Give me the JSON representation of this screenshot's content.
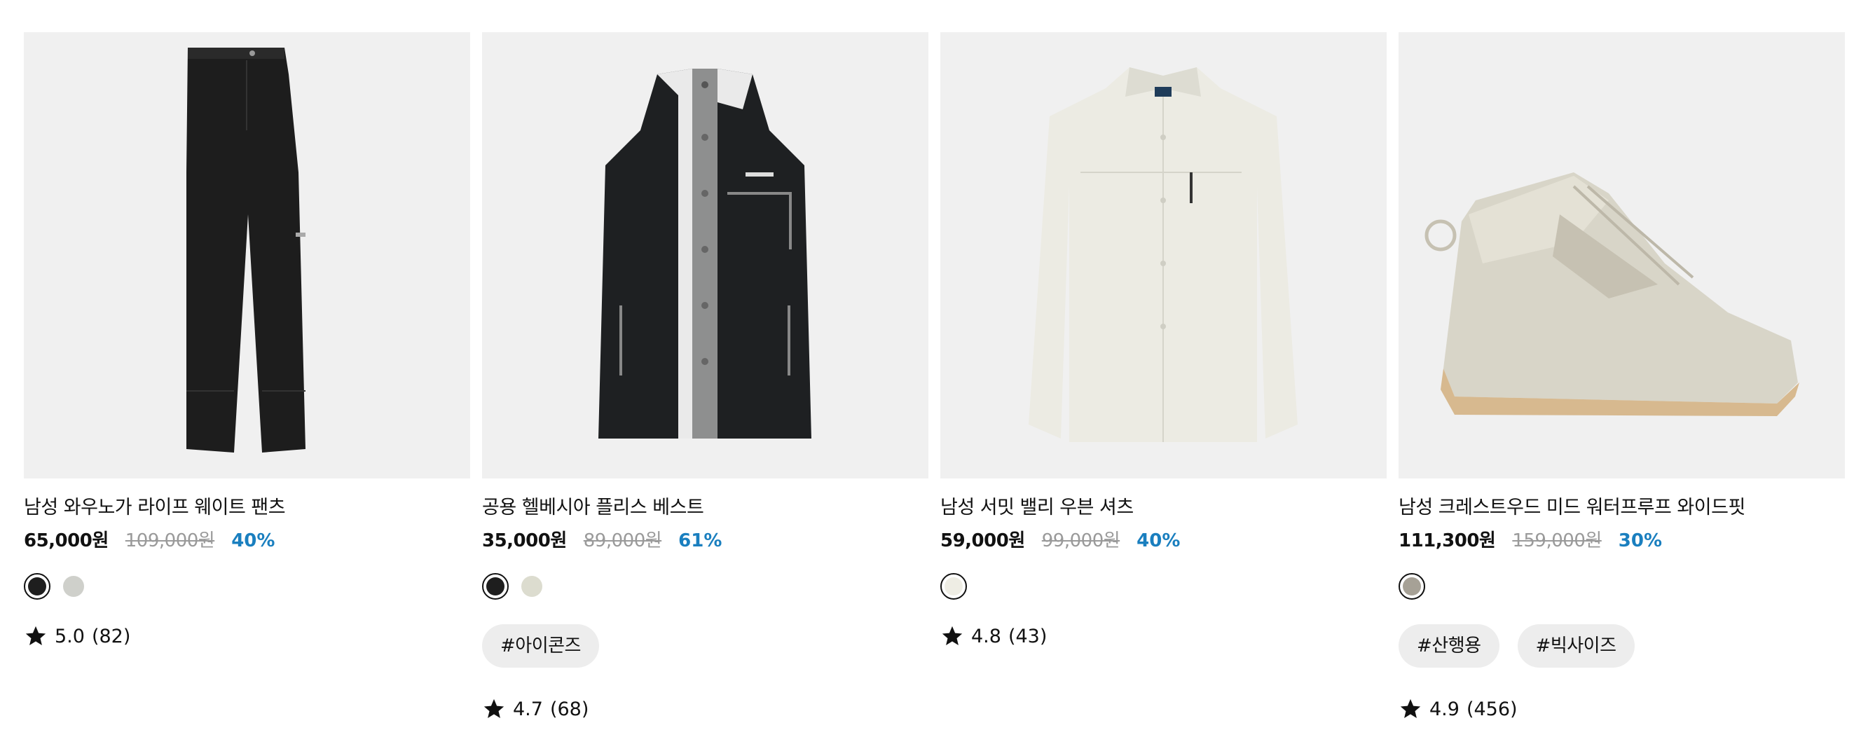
{
  "products": [
    {
      "name": "남성 와우노가 라이프 웨이트 팬츠",
      "price": "65,000원",
      "original_price": "109,000원",
      "discount": "40%",
      "swatches": [
        {
          "color": "#1e1e1e",
          "selected": true
        },
        {
          "color": "#cfd0cb",
          "selected": false
        }
      ],
      "tags": [],
      "rating": "5.0",
      "reviews": "(82)",
      "image_icon": "pants-image"
    },
    {
      "name": "공용 헬베시아 플리스 베스트",
      "price": "35,000원",
      "original_price": "89,000원",
      "discount": "61%",
      "swatches": [
        {
          "color": "#1e1e1e",
          "selected": true
        },
        {
          "color": "#dcdccf",
          "selected": false
        }
      ],
      "tags": [
        "#아이콘즈"
      ],
      "rating": "4.7",
      "reviews": "(68)",
      "image_icon": "fleece-vest-image"
    },
    {
      "name": "남성 서밋 밸리 우븐 셔츠",
      "price": "59,000원",
      "original_price": "99,000원",
      "discount": "40%",
      "swatches": [
        {
          "color": "#eeede4",
          "selected": true
        }
      ],
      "tags": [],
      "rating": "4.8",
      "reviews": "(43)",
      "image_icon": "shirt-image"
    },
    {
      "name": "남성 크레스트우드 미드 워터프루프 와이드핏",
      "price": "111,300원",
      "original_price": "159,000원",
      "discount": "30%",
      "swatches": [
        {
          "color": "#a6a196",
          "selected": true
        }
      ],
      "tags": [
        "#산행용",
        "#빅사이즈"
      ],
      "rating": "4.9",
      "reviews": "(456)",
      "image_icon": "hiking-boot-image"
    }
  ]
}
